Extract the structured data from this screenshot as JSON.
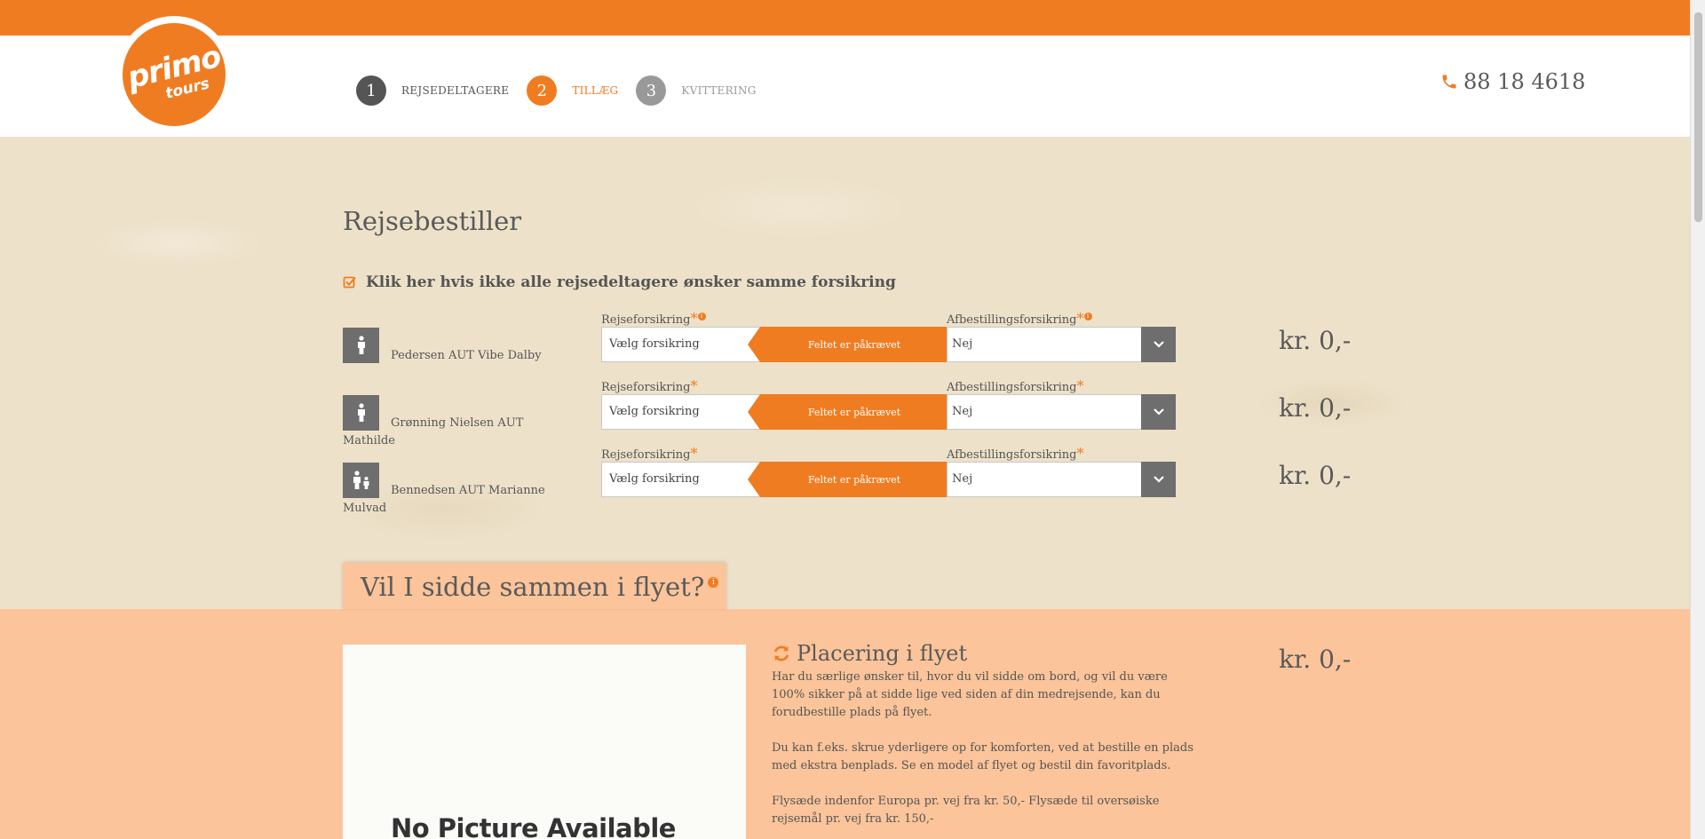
{
  "brand": {
    "logo_line1": "primo",
    "logo_line2": "tours",
    "accent_color": "#f07c22"
  },
  "header": {
    "steps": [
      {
        "num": "1",
        "label": "REJSEDELTAGERE"
      },
      {
        "num": "2",
        "label": "TILLÆG"
      },
      {
        "num": "3",
        "label": "KVITTERING"
      }
    ],
    "phone_icon": "phone-icon",
    "phone": "88 18 4618"
  },
  "booker": {
    "title": "Rejsebestiller",
    "check_icon": "checkbox-checked-icon",
    "checkbox_label": "Klik her hvis ikke alle rejsedeltagere ønsker samme forsikring"
  },
  "passengers": [
    {
      "name": "Pedersen AUT Vibe Dalby",
      "icon": "adult-person-icon",
      "travel_label": "Rejseforsikring",
      "travel_value": "Vælg forsikring",
      "error": "Feltet er påkrævet",
      "cancel_label": "Afbestillingsforsikring",
      "cancel_value": "Nej",
      "price": "kr. 0,-"
    },
    {
      "name": "Grønning Nielsen AUT Mathilde",
      "icon": "adult-person-icon",
      "travel_label": "Rejseforsikring",
      "travel_value": "Vælg forsikring",
      "error": "Feltet er påkrævet",
      "cancel_label": "Afbestillingsforsikring",
      "cancel_value": "Nej",
      "price": "kr. 0,-"
    },
    {
      "name": "Bennedsen AUT Marianne Mulvad",
      "icon": "adult-with-child-icon",
      "travel_label": "Rejseforsikring",
      "travel_value": "Vælg forsikring",
      "error": "Feltet er påkrævet",
      "cancel_label": "Afbestillingsforsikring",
      "cancel_value": "Nej",
      "price": "kr. 0,-"
    }
  ],
  "required_mark": "*",
  "seating": {
    "tab_title": "Vil I sidde sammen i flyet?",
    "image_text": "No Picture Available",
    "title": "Placering i flyet",
    "paragraphs": [
      "Har du særlige ønsker til, hvor du vil sidde om bord, og vil du være 100% sikker på at sidde lige ved siden af din medrejsende, kan du forudbestille plads på flyet.",
      "Du kan f.eks. skrue yderligere op for komforten, ved at bestille en plads med ekstra benplads. Se en model af flyet og bestil din favoritplads.",
      "Flysæde indenfor Europa pr. vej fra kr. 50,- Flysæde til oversøiske rejsemål pr. vej fra kr. 150,-"
    ],
    "price": "kr. 0,-"
  }
}
